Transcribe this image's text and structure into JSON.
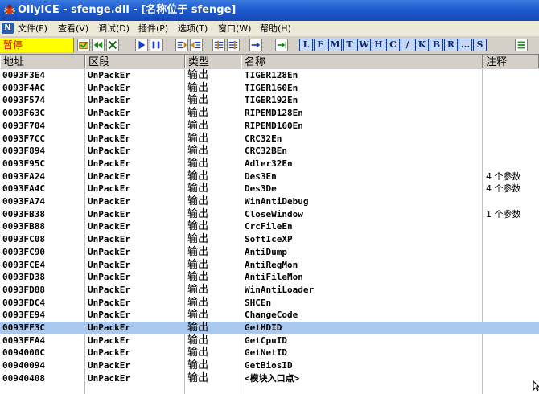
{
  "window": {
    "title": "OllyICE - sfenge.dll - [名称位于 sfenge]"
  },
  "menu": {
    "items": [
      "文件(F)",
      "查看(V)",
      "调试(D)",
      "插件(P)",
      "选项(T)",
      "窗口(W)",
      "帮助(H)"
    ]
  },
  "toolbar": {
    "status": "暂停",
    "letter_buttons": [
      "L",
      "E",
      "M",
      "T",
      "W",
      "H",
      "C",
      "/",
      "K",
      "B",
      "R",
      "...",
      "S"
    ]
  },
  "table": {
    "columns": [
      "地址",
      "区段",
      "类型",
      "名称",
      "注释"
    ],
    "rows": [
      {
        "address": "0093F3E4",
        "section": "UnPackEr",
        "type": "输出",
        "name": "TIGER128En",
        "comment": ""
      },
      {
        "address": "0093F4AC",
        "section": "UnPackEr",
        "type": "输出",
        "name": "TIGER160En",
        "comment": ""
      },
      {
        "address": "0093F574",
        "section": "UnPackEr",
        "type": "输出",
        "name": "TIGER192En",
        "comment": ""
      },
      {
        "address": "0093F63C",
        "section": "UnPackEr",
        "type": "输出",
        "name": "RIPEMD128En",
        "comment": ""
      },
      {
        "address": "0093F704",
        "section": "UnPackEr",
        "type": "输出",
        "name": "RIPEMD160En",
        "comment": ""
      },
      {
        "address": "0093F7CC",
        "section": "UnPackEr",
        "type": "输出",
        "name": "CRC32En",
        "comment": ""
      },
      {
        "address": "0093F894",
        "section": "UnPackEr",
        "type": "输出",
        "name": "CRC32BEn",
        "comment": ""
      },
      {
        "address": "0093F95C",
        "section": "UnPackEr",
        "type": "输出",
        "name": "Adler32En",
        "comment": ""
      },
      {
        "address": "0093FA24",
        "section": "UnPackEr",
        "type": "输出",
        "name": "Des3En",
        "comment": "4 个参数"
      },
      {
        "address": "0093FA4C",
        "section": "UnPackEr",
        "type": "输出",
        "name": "Des3De",
        "comment": "4 个参数"
      },
      {
        "address": "0093FA74",
        "section": "UnPackEr",
        "type": "输出",
        "name": "WinAntiDebug",
        "comment": ""
      },
      {
        "address": "0093FB38",
        "section": "UnPackEr",
        "type": "输出",
        "name": "CloseWindow",
        "comment": "1 个参数"
      },
      {
        "address": "0093FB88",
        "section": "UnPackEr",
        "type": "输出",
        "name": "CrcFileEn",
        "comment": ""
      },
      {
        "address": "0093FC08",
        "section": "UnPackEr",
        "type": "输出",
        "name": "SoftIceXP",
        "comment": ""
      },
      {
        "address": "0093FC90",
        "section": "UnPackEr",
        "type": "输出",
        "name": "AntiDump",
        "comment": ""
      },
      {
        "address": "0093FCE4",
        "section": "UnPackEr",
        "type": "输出",
        "name": "AntiRegMon",
        "comment": ""
      },
      {
        "address": "0093FD38",
        "section": "UnPackEr",
        "type": "输出",
        "name": "AntiFileMon",
        "comment": ""
      },
      {
        "address": "0093FD88",
        "section": "UnPackEr",
        "type": "输出",
        "name": "WinAntiLoader",
        "comment": ""
      },
      {
        "address": "0093FDC4",
        "section": "UnPackEr",
        "type": "输出",
        "name": "SHCEn",
        "comment": ""
      },
      {
        "address": "0093FE94",
        "section": "UnPackEr",
        "type": "输出",
        "name": "ChangeCode",
        "comment": ""
      },
      {
        "address": "0093FF3C",
        "section": "UnPackEr",
        "type": "输出",
        "name": "GetHDID",
        "comment": "",
        "selected": true
      },
      {
        "address": "0093FFA4",
        "section": "UnPackEr",
        "type": "输出",
        "name": "GetCpuID",
        "comment": ""
      },
      {
        "address": "0094000C",
        "section": "UnPackEr",
        "type": "输出",
        "name": "GetNetID",
        "comment": ""
      },
      {
        "address": "00940094",
        "section": "UnPackEr",
        "type": "输出",
        "name": "GetBiosID",
        "comment": ""
      },
      {
        "address": "00940408",
        "section": "UnPackEr",
        "type": "输出",
        "name": "<模块入口点>",
        "comment": ""
      }
    ]
  },
  "colors": {
    "title_bar": "#1d5bd0",
    "selection": "#a8c8f0",
    "status_bg": "#ffff00",
    "status_fg": "#d00000"
  },
  "icons": [
    "bug-icon",
    "mdi-document-icon",
    "open-file-icon",
    "rewind-icon",
    "close-icon",
    "run-icon",
    "pause-icon",
    "step-into-icon",
    "step-over-icon",
    "trace-into-icon",
    "trace-over-icon",
    "execute-till-return-icon",
    "goto-icon",
    "list-icon",
    "mouse-cursor-icon"
  ]
}
